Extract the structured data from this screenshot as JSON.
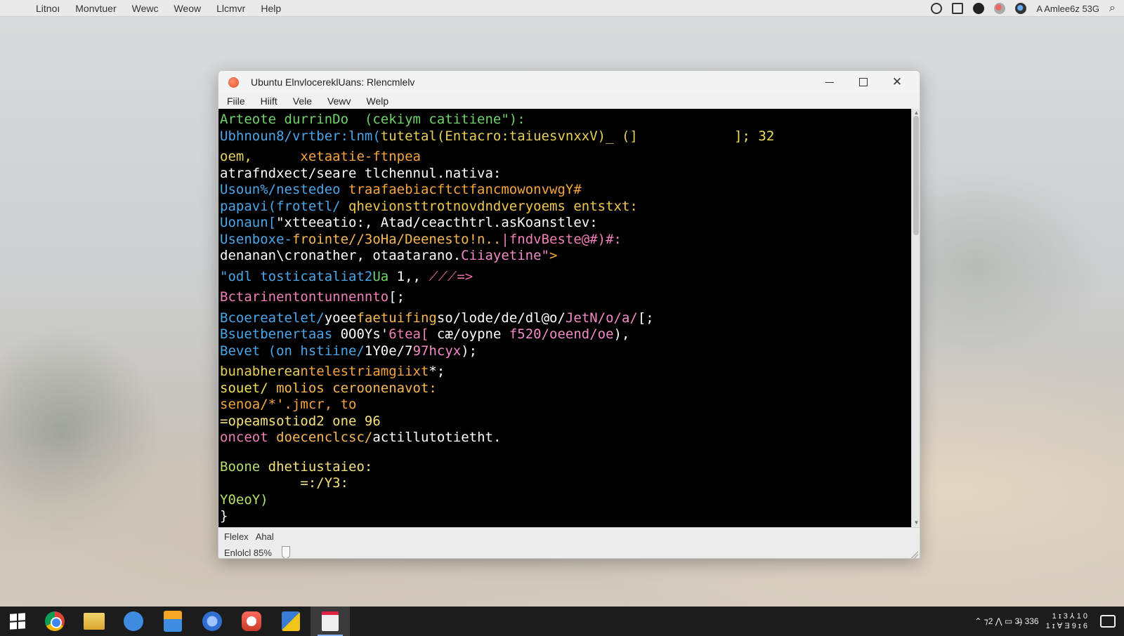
{
  "topbar": {
    "apple_glyph": "",
    "menus": [
      "Litnoı",
      "Monvtuer",
      "Wewc",
      "Weow",
      "Llcmvr",
      "Help"
    ],
    "user_label": "A Amlee6z 53G",
    "search_glyph": "⌕"
  },
  "window": {
    "title": "Ubuntu  ElnvlocereklUans: Rlencmlelv",
    "controls": {
      "close": "✕"
    },
    "menus": [
      "Fiile",
      "Hiift",
      "Vele",
      "Vewv",
      "Welp"
    ]
  },
  "terminal": {
    "lines": [
      {
        "segments": [
          {
            "text": "Arteote durrinDo  (cekiym catitiene\"):",
            "color": "#6fd36a"
          }
        ]
      },
      {
        "segments": [
          {
            "text": "Ubhnoun8/vrtber:lnm(",
            "color": "#4aa6e8"
          },
          {
            "text": "tutetal(Entacro:taiuesvnxxV)_ (]",
            "color": "#e7cf5a"
          },
          {
            "text": "            ]; 32",
            "color": "#f1e05a"
          }
        ]
      },
      {
        "gap": true
      },
      {
        "segments": [
          {
            "text": "oem,      ",
            "color": "#e7d45a"
          },
          {
            "text": "xetaatie-ftnpea",
            "color": "#f4a43c"
          }
        ]
      },
      {
        "segments": [
          {
            "text": "atrafndxect/seare tlchennul.nativa:",
            "color": "#ffffff"
          }
        ]
      },
      {
        "segments": [
          {
            "text": "Usoun%/nestedeo ",
            "color": "#4aa6e8"
          },
          {
            "text": "traafaebiacftctfancmowonvwgY#",
            "color": "#f5a53d"
          }
        ]
      },
      {
        "segments": [
          {
            "text": "papavi(frotetl/ ",
            "color": "#4aa6e8"
          },
          {
            "text": "qhevionsttrotnovdndveryoems entstxt:",
            "color": "#f1c84c"
          }
        ]
      },
      {
        "segments": [
          {
            "text": "Uonaun[",
            "color": "#4aa6e8"
          },
          {
            "text": "\"xtteeatio:, Atad/ceacthtrl.asKoanstlev:",
            "color": "#ffffff"
          }
        ]
      },
      {
        "segments": [
          {
            "text": "Usenboxe-",
            "color": "#4aa6e8"
          },
          {
            "text": "frointe//3oHa/Deenesto!n..",
            "color": "#f7b852"
          },
          {
            "text": "|fndvBeste@#)#:",
            "color": "#f07fb8"
          }
        ]
      },
      {
        "segments": [
          {
            "text": "denanan\\cronather, otaatarano.",
            "color": "#ffffff"
          },
          {
            "text": "Ciiayetine\"",
            "color": "#f28bc7"
          },
          {
            "text": ">",
            "color": "#f5a53d"
          }
        ]
      },
      {
        "gap": true
      },
      {
        "segments": [
          {
            "text": "\"odl tosticataliat2",
            "color": "#4aa6e8"
          },
          {
            "text": "Ua",
            "color": "#6fd36a"
          },
          {
            "text": " 1,, ",
            "color": "#ffffff"
          },
          {
            "text": "⟋⟋⟋=>",
            "color": "#e86ba8"
          }
        ]
      },
      {
        "gap": true
      },
      {
        "segments": [
          {
            "text": "Bctarinentontunnennto",
            "color": "#f07fb8"
          },
          {
            "text": "[;",
            "color": "#ffffff"
          }
        ]
      },
      {
        "gap": true
      },
      {
        "segments": [
          {
            "text": "Bcoereatelet/",
            "color": "#4aa6e8"
          },
          {
            "text": "yoee",
            "color": "#ffffff"
          },
          {
            "text": "faetuifing",
            "color": "#f7b852"
          },
          {
            "text": "so/lode/de/dl@o/",
            "color": "#ffffff"
          },
          {
            "text": "JetN/o/a/",
            "color": "#f28bc7"
          },
          {
            "text": "[;",
            "color": "#ffffff"
          }
        ]
      },
      {
        "segments": [
          {
            "text": "Bsuetbenertaas ",
            "color": "#4aa6e8"
          },
          {
            "text": "0O0Ys'",
            "color": "#ffffff"
          },
          {
            "text": "6tea[",
            "color": "#f07fb8"
          },
          {
            "text": " cæ/oypne ",
            "color": "#ffffff"
          },
          {
            "text": "f520/oeend/oe",
            "color": "#f28bc7"
          },
          {
            "text": "),",
            "color": "#ffffff"
          }
        ]
      },
      {
        "segments": [
          {
            "text": "Bevet ",
            "color": "#4aa6e8"
          },
          {
            "text": "(on hstiine/",
            "color": "#4aa6e8"
          },
          {
            "text": "1Y0e/7",
            "color": "#ffffff"
          },
          {
            "text": "97hcyx",
            "color": "#f28bc7"
          },
          {
            "text": ");",
            "color": "#ffffff"
          }
        ]
      },
      {
        "gap": true
      },
      {
        "segments": [
          {
            "text": "bunabherea",
            "color": "#e7cf5a"
          },
          {
            "text": "ntelestriamgiixt",
            "color": "#f5a53d"
          },
          {
            "text": "*;",
            "color": "#ffffff"
          }
        ]
      },
      {
        "segments": [
          {
            "text": "souet/ ",
            "color": "#f1e05a"
          },
          {
            "text": "molios ceroonenavot:",
            "color": "#f7b852"
          }
        ]
      },
      {
        "segments": [
          {
            "text": "senoa/*'.jmcr, to",
            "color": "#f5a53d"
          }
        ]
      },
      {
        "segments": [
          {
            "text": "=opeamsotiod2 one 96",
            "color": "#f5e27a"
          }
        ]
      },
      {
        "segments": [
          {
            "text": "onceot ",
            "color": "#f07fb8"
          },
          {
            "text": "doecenclcsc/",
            "color": "#f7b852"
          },
          {
            "text": "actillutotietht.",
            "color": "#ffffff"
          }
        ]
      },
      {
        "gap2": true
      },
      {
        "segments": [
          {
            "text": "Boone ",
            "color": "#b6e06a"
          },
          {
            "text": "dhetiustaieo:",
            "color": "#f5e27a"
          }
        ]
      },
      {
        "segments": [
          {
            "text": "          =:/Y3:",
            "color": "#f5e27a"
          }
        ]
      },
      {
        "segments": [
          {
            "text": "Y0eoY)",
            "color": "#b6e06a"
          }
        ]
      },
      {
        "segments": [
          {
            "text": "}",
            "color": "#ffffff"
          }
        ]
      }
    ]
  },
  "statusbar": {
    "line1_a": "Flelex",
    "line1_b": "Ahal",
    "line2": "Enlolcl 85%"
  },
  "taskbar": {
    "apps": [
      "chrome",
      "file-explorer",
      "mail",
      "documents",
      "browser",
      "red-app",
      "maps",
      "notepad"
    ],
    "tray_text": "⌃ ⁊2  ⋀  ▭  3̶)   336",
    "clock_line1": "1 ɪ 3 ⅄ 1 0",
    "clock_line2": "1 ɪ ∀ Ǝ 9 ɪ 6"
  },
  "colors": {
    "terminal_bg": "#000000",
    "window_bg": "#f1f1f1",
    "taskbar_bg": "#1c1c1c"
  }
}
